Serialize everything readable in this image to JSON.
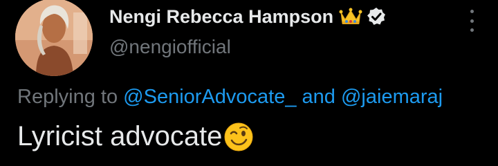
{
  "author": {
    "display_name": "Nengi Rebecca Hampson",
    "handle": "@nengiofficial",
    "badges": [
      "crown-emoji",
      "verified-badge"
    ],
    "avatar": "profile-photo"
  },
  "reply": {
    "prefix": "Replying to",
    "mention_1": "@SeniorAdvocate_",
    "conjunction": "and",
    "mention_2": "@jaiemaraj"
  },
  "tweet": {
    "text": "Lyricist advocate",
    "emoji": "winking-face-emoji"
  },
  "menu": {
    "icon": "more-options-icon"
  },
  "colors": {
    "background": "#000000",
    "primary_text": "#e7e9ea",
    "secondary_text": "#71767b",
    "link": "#1d9bf0"
  }
}
